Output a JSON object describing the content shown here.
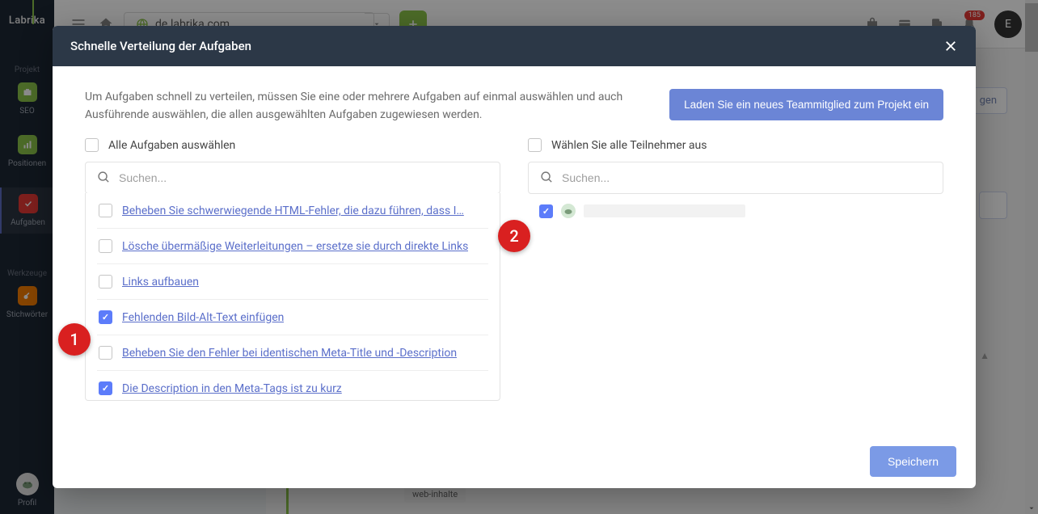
{
  "app": {
    "logo": "Labrika"
  },
  "sidebar": {
    "group1_label": "Projekt",
    "items": [
      {
        "label": "SEO"
      },
      {
        "label": "Positionen"
      },
      {
        "label": "Aufgaben"
      }
    ],
    "group2_label": "Werkzeuge",
    "tools": [
      {
        "label": "Stichwörter"
      }
    ],
    "profile_label": "Profil"
  },
  "topbar": {
    "url": "de.labrika.com",
    "user_initial": "E",
    "badge_count": "185"
  },
  "modal": {
    "title": "Schnelle Verteilung der Aufgaben",
    "intro": "Um Aufgaben schnell zu verteilen, müssen Sie eine oder mehrere Aufgaben auf einmal auswählen und auch Ausführende auswählen, die allen ausgewählten Aufgaben zugewiesen werden.",
    "invite_label": "Laden Sie ein neues Teammitglied zum Projekt ein",
    "tasks": {
      "select_all": "Alle Aufgaben auswählen",
      "search_placeholder": "Suchen...",
      "items": [
        {
          "label": "Beheben Sie schwerwiegende HTML-Fehler, die dazu führen, dass I…",
          "checked": false
        },
        {
          "label": "Lösche übermäßige Weiterleitungen – ersetze sie durch direkte Links",
          "checked": false
        },
        {
          "label": "Links aufbauen",
          "checked": false
        },
        {
          "label": "Fehlenden Bild-Alt-Text einfügen",
          "checked": true
        },
        {
          "label": "Beheben Sie den Fehler bei identischen Meta-Title und -Description",
          "checked": false
        },
        {
          "label": "Die Description in den Meta-Tags ist zu kurz",
          "checked": true
        }
      ]
    },
    "participants": {
      "select_all": "Wählen Sie alle Teilnehmer aus",
      "search_placeholder": "Suchen...",
      "items": [
        {
          "checked": true
        }
      ]
    },
    "save_label": "Speichern"
  },
  "callouts": {
    "one": "1",
    "two": "2"
  },
  "background": {
    "btn_right": "gen",
    "tag": "web-inhalte",
    "sort": "▲"
  }
}
